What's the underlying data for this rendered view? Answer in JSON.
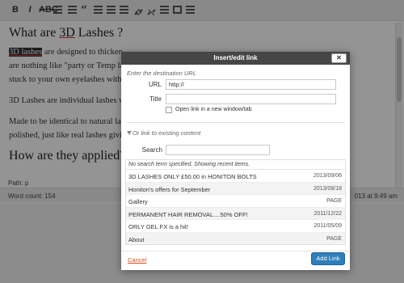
{
  "toolbar": {
    "bold_label": "B",
    "italic_label": "I",
    "icons": [
      "bullet-list-icon",
      "numbered-list-icon",
      "blockquote-icon",
      "align-left-icon",
      "align-center-icon",
      "align-right-icon",
      "link-icon",
      "unlink-icon",
      "insert-more-icon",
      "fullscreen-icon",
      "kitchen-sink-icon"
    ]
  },
  "editor": {
    "heading1_before": "What are ",
    "heading1_link": "3D",
    "heading1_after": " Lashes ?",
    "para1_highlight": "3D lashes",
    "para1_rest": " are designed to thicken",
    "para1_line2": "are nothing like \"party or Temp la",
    "para1_line3": "stuck to your own eyelashes with",
    "para2": "3D Lashes are individual lashes wh",
    "para3_line1": "Made to be identical to natural las",
    "para3_line2": "polished, just like real lashes givin",
    "heading2": "How are they applied?",
    "path": "Path: p",
    "word_count": "Word count: 154",
    "last_edited": "013 at 9:49 am"
  },
  "dialog": {
    "title": "Insert/edit link",
    "close_label": "✕",
    "destination_label": "Enter the destination URL",
    "url_label": "URL",
    "url_value": "http://",
    "title_label": "Title",
    "title_value": "",
    "new_tab_label": "Open link in a new window/tab",
    "existing_toggle": "Or link to existing content",
    "search_label": "Search",
    "search_value": "",
    "results_note": "No search term specified. Showing recent items.",
    "results": [
      {
        "title": "3D LASHES ONLY £50.00 in HONITON BOLTS",
        "info": "2013/09/06"
      },
      {
        "title": "Honiton's offers for September",
        "info": "2013/08/18"
      },
      {
        "title": "Gallery",
        "info": "PAGE"
      },
      {
        "title": "PERMANENT HAIR REMOVAL....50% OFF!",
        "info": "2011/12/22"
      },
      {
        "title": "ORLY GEL FX is a hit!",
        "info": "2011/05/09"
      },
      {
        "title": "About",
        "info": "PAGE"
      }
    ],
    "cancel_label": "Cancel",
    "add_link_label": "Add Link"
  }
}
